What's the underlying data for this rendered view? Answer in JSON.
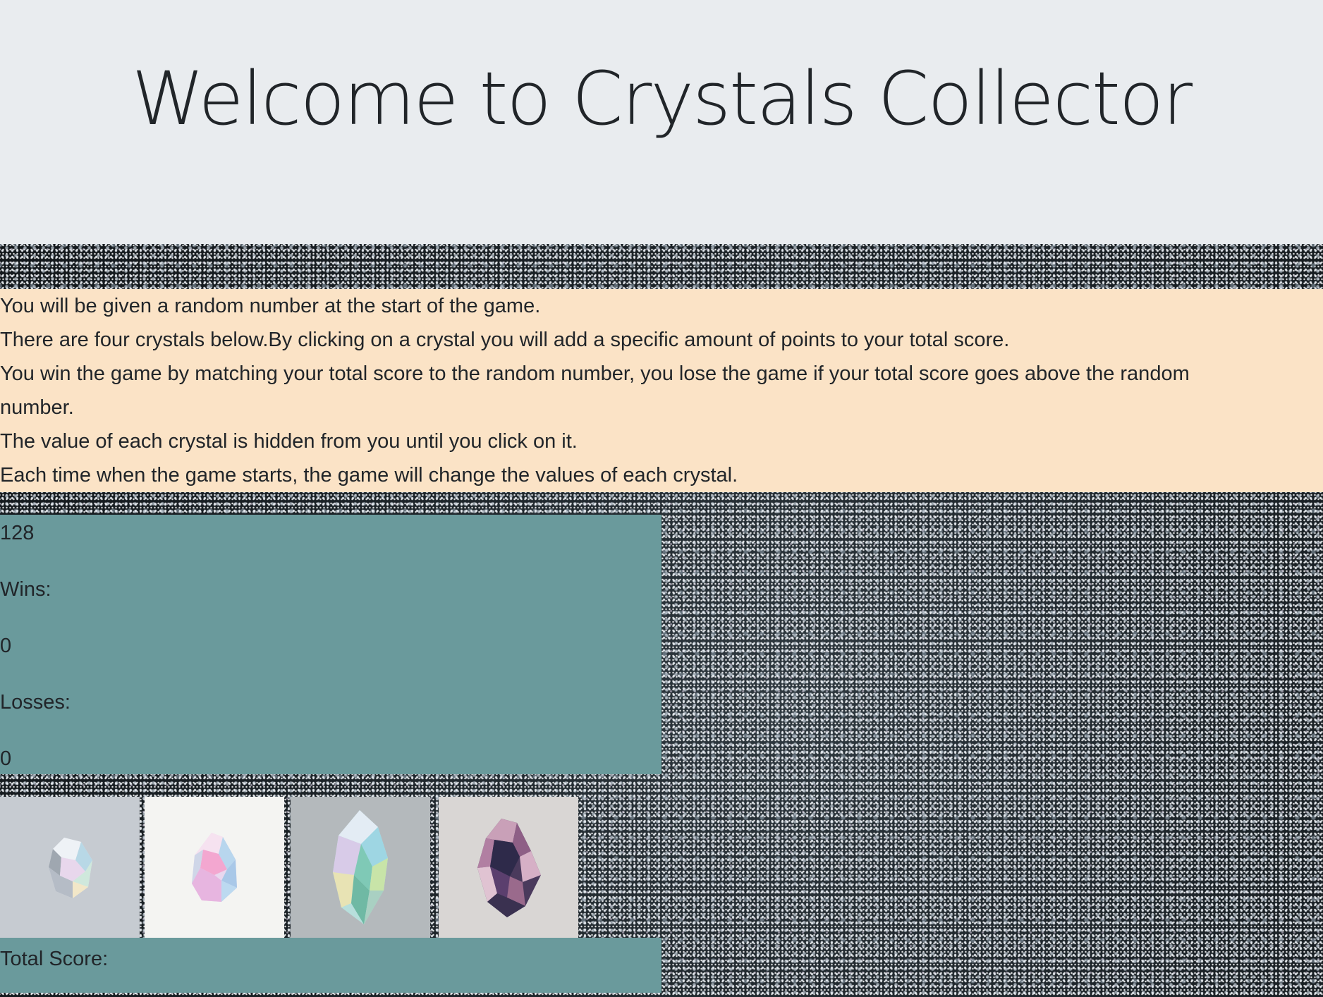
{
  "header": {
    "title": "Welcome to Crystals Collector"
  },
  "instructions": [
    "You will be given a random number at the start of the game.",
    "There are four crystals below.By clicking on a crystal you will add a specific amount of points to your total score.",
    "You win the game by matching your total score to the random number, you lose the game if your total score goes above the random number.",
    "The value of each crystal is hidden from you until you click on it.",
    "Each time when the game starts, the game will change the values of each crystal."
  ],
  "stats": {
    "random_number": "128",
    "wins_label": "Wins:",
    "wins_value": "0",
    "losses_label": "Losses:",
    "losses_value": "0"
  },
  "crystals": [
    {
      "icon": "crystal-1-icon",
      "bg": "#c6cbd1"
    },
    {
      "icon": "crystal-2-icon",
      "bg": "#f4f4f2"
    },
    {
      "icon": "crystal-3-icon",
      "bg": "#b4b9bc"
    },
    {
      "icon": "crystal-4-icon",
      "bg": "#d9d6d4"
    }
  ],
  "score": {
    "label": "Total Score:",
    "value": ""
  },
  "colors": {
    "jumbotron_bg": "#e9ecef",
    "instructions_bg": "#fbe3c6",
    "panel_bg": "#6a9a9c",
    "text": "#212529"
  }
}
